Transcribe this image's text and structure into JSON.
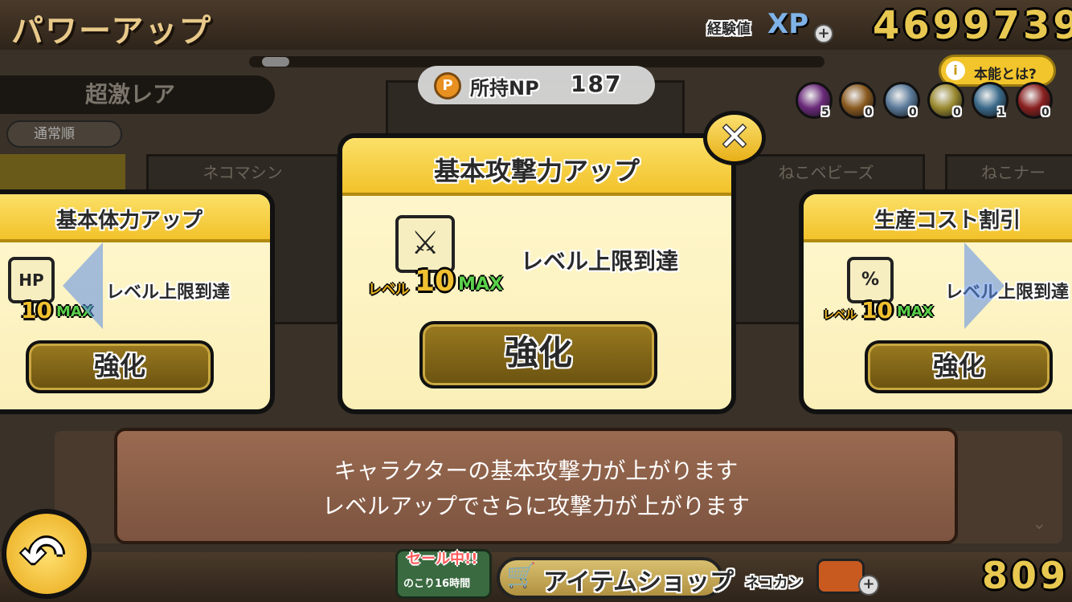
{
  "header": {
    "title": "パワーアップ",
    "xp_label": "経験値",
    "xp_badge": "XP",
    "xp_plus": "+",
    "xp_value": "4699739"
  },
  "background": {
    "rarity_tab": "超激レア",
    "sort_button": "通常順",
    "cards": [
      "ネコマシン",
      "ねこベビーズ",
      "ねこナー"
    ]
  },
  "np": {
    "coin_icon": "P",
    "label": "所持NP",
    "value": "187"
  },
  "instinct": {
    "icon": "i",
    "label": "本能とは?"
  },
  "orbs": [
    {
      "count": "5",
      "color": "#6a2a7a"
    },
    {
      "count": "0",
      "color": "#8a5a20"
    },
    {
      "count": "0",
      "color": "#5a7a9a"
    },
    {
      "count": "0",
      "color": "#9a8a30"
    },
    {
      "count": "1",
      "color": "#3a6a8a"
    },
    {
      "count": "0",
      "color": "#8a2020"
    }
  ],
  "cards": {
    "left": {
      "title": "基本体力アップ",
      "icon": "HP",
      "level_label": "レベル",
      "level": "10",
      "max": "MAX",
      "status": "レベル上限到達",
      "button": "強化"
    },
    "center": {
      "title": "基本攻撃力アップ",
      "icon": "⚔",
      "level_label": "レベル",
      "level": "10",
      "max": "MAX",
      "status": "レベル上限到達",
      "button": "強化"
    },
    "right": {
      "title": "生産コスト割引",
      "icon": "%",
      "level_label": "レベル",
      "level": "10",
      "max": "MAX",
      "status": "レベル上限到達",
      "button": "強化"
    }
  },
  "close_icon": "✕",
  "description": {
    "line1": "キャラクターの基本攻撃力が上がります",
    "line2": "レベルアップでさらに攻撃力が上がります",
    "chevron": "⌄"
  },
  "footer": {
    "back_icon": "↶",
    "sale_label": "セール中!!",
    "sale_time": "のこり16時間",
    "cart_icon": "🛒",
    "item_shop": "アイテムショップ",
    "catfood_label": "ネコカン",
    "catfood_plus": "+",
    "catfood_value": "809"
  }
}
